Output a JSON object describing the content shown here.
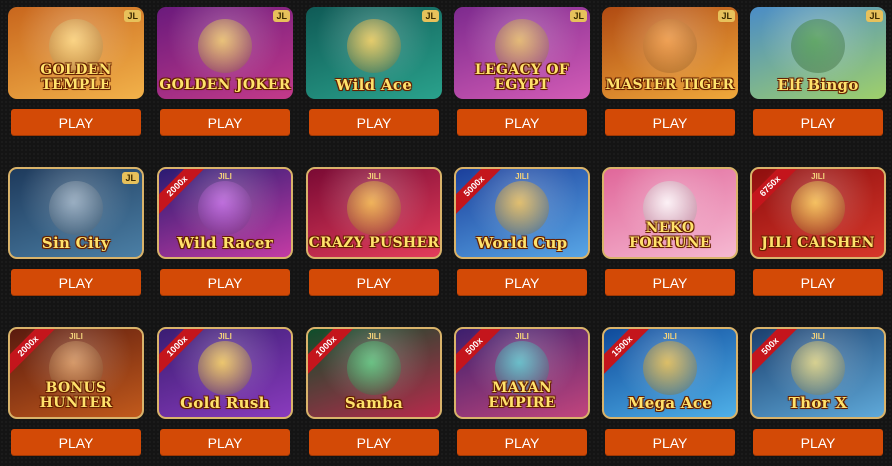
{
  "play_label": "PLAY",
  "games": [
    {
      "title": "Golden Temple",
      "brand": "JL",
      "ribbon": "",
      "bg": [
        "#c8661d",
        "#f2b24a"
      ],
      "accent": "#ffd36b"
    },
    {
      "title": "Golden Joker",
      "brand": "JL",
      "ribbon": "",
      "bg": [
        "#6a1a7c",
        "#c33a8a"
      ],
      "accent": "#f2c84c"
    },
    {
      "title": "Wild Ace",
      "brand": "JL",
      "ribbon": "",
      "bg": [
        "#0f5a56",
        "#2aa28c"
      ],
      "accent": "#ffc93b"
    },
    {
      "title": "Legacy of Egypt",
      "brand": "JL",
      "ribbon": "",
      "bg": [
        "#7d2a8e",
        "#d35cb6"
      ],
      "accent": "#e6b845"
    },
    {
      "title": "Master Tiger",
      "brand": "JL",
      "ribbon": "",
      "bg": [
        "#b04a12",
        "#f0a93b"
      ],
      "accent": "#f08a25"
    },
    {
      "title": "Elf Bingo",
      "brand": "JL",
      "ribbon": "",
      "bg": [
        "#4a8cc7",
        "#9fd06a"
      ],
      "accent": "#2d8a2d"
    },
    {
      "title": "Sin City",
      "brand": "JL",
      "ribbon": "",
      "bg": [
        "#1e3a5c",
        "#4b7fa5"
      ],
      "accent": "#8ba3ba"
    },
    {
      "title": "Wild Racer",
      "brand": "JILI",
      "ribbon": "2000x",
      "bg": [
        "#2a1b72",
        "#c43ba4"
      ],
      "accent": "#b84de0"
    },
    {
      "title": "Crazy Pusher",
      "brand": "JILI",
      "ribbon": "",
      "bg": [
        "#7a0a34",
        "#e43d5b"
      ],
      "accent": "#f8b52a"
    },
    {
      "title": "World Cup",
      "brand": "JILI",
      "ribbon": "5000x",
      "bg": [
        "#1b3f9b",
        "#58a6e6"
      ],
      "accent": "#f5b935"
    },
    {
      "title": "Neko Fortune",
      "brand": "",
      "ribbon": "",
      "bg": [
        "#e0679a",
        "#f6b9d2"
      ],
      "accent": "#ffffff"
    },
    {
      "title": "Jili Caishen",
      "brand": "JILI",
      "ribbon": "6750x",
      "bg": [
        "#8f0e0e",
        "#d7372a"
      ],
      "accent": "#ffc93b"
    },
    {
      "title": "Bonus Hunter",
      "brand": "JILI",
      "ribbon": "2000x",
      "bg": [
        "#5a1a0e",
        "#c25a1c"
      ],
      "accent": "#d68b4a"
    },
    {
      "title": "Gold Rush",
      "brand": "JILI",
      "ribbon": "1000x",
      "bg": [
        "#3a1d73",
        "#8a3bbd"
      ],
      "accent": "#ffcf3a"
    },
    {
      "title": "Samba",
      "brand": "JILI",
      "ribbon": "1000x",
      "bg": [
        "#0e4d2a",
        "#b82a4c"
      ],
      "accent": "#3fc46a"
    },
    {
      "title": "Mayan Empire",
      "brand": "JILI",
      "ribbon": "500x",
      "bg": [
        "#3c1f6d",
        "#c2457d"
      ],
      "accent": "#3ac2c7"
    },
    {
      "title": "Mega Ace",
      "brand": "JILI",
      "ribbon": "1500x",
      "bg": [
        "#0f4a9b",
        "#4fb0e8"
      ],
      "accent": "#f0b628"
    },
    {
      "title": "Thor X",
      "brand": "JILI",
      "ribbon": "500x",
      "bg": [
        "#1a3f6e",
        "#5fa9d9"
      ],
      "accent": "#e6d36b"
    }
  ]
}
